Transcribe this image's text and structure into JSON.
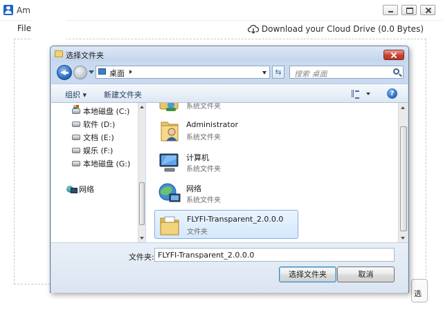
{
  "app": {
    "title": "Am          d Drive",
    "menu_file": "File",
    "download_link": "Download your Cloud Drive (0.0 Bytes)",
    "select_button_partial": "选"
  },
  "dialog": {
    "title": "选择文件夹",
    "address_location": "桌面",
    "search_placeholder": "搜索 桌面",
    "organize_label": "组织 ▾",
    "new_folder_label": "新建文件夹",
    "help_label": "?",
    "nav_items": [
      {
        "label": "本地磁盘 (C:)",
        "icon": "system-drive-icon"
      },
      {
        "label": "软件 (D:)",
        "icon": "drive-icon"
      },
      {
        "label": "文档 (E:)",
        "icon": "drive-icon"
      },
      {
        "label": "娱乐 (F:)",
        "icon": "drive-icon"
      },
      {
        "label": "本地磁盘 (G:)",
        "icon": "drive-icon"
      },
      {
        "label": "网络",
        "icon": "network-icon"
      }
    ],
    "files": [
      {
        "name": "",
        "type": "系统文件夹",
        "icon": "user-folder-icon"
      },
      {
        "name": "Administrator",
        "type": "系统文件夹",
        "icon": "user-folder-icon"
      },
      {
        "name": "计算机",
        "type": "系统文件夹",
        "icon": "computer-icon"
      },
      {
        "name": "网络",
        "type": "系统文件夹",
        "icon": "network-icon"
      },
      {
        "name": "FLYFI-Transparent_2.0.0.0",
        "type": "文件夹",
        "icon": "folder-icon",
        "selected": true
      }
    ],
    "folder_field_label": "文件夹:",
    "folder_field_value": "FLYFI-Transparent_2.0.0.0",
    "select_folder_button": "选择文件夹",
    "cancel_button": "取消"
  }
}
